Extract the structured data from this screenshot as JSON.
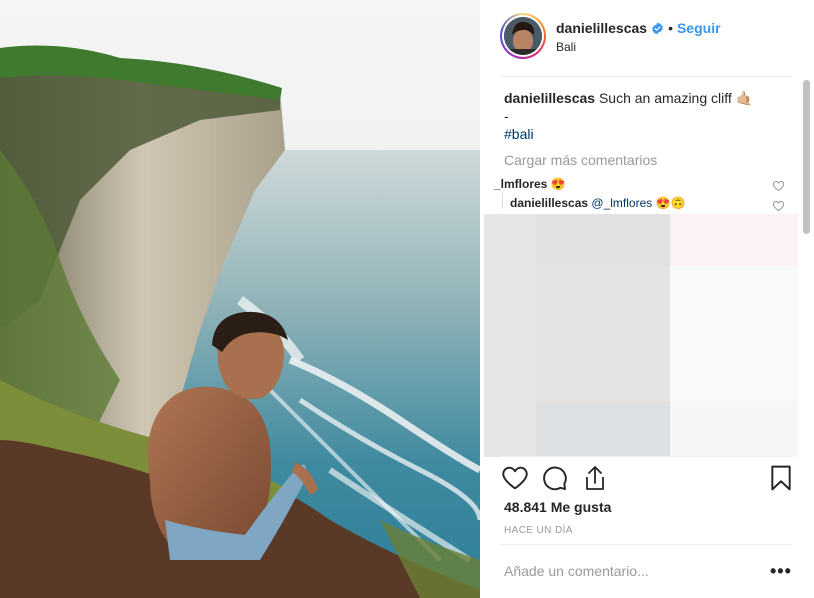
{
  "post": {
    "image_alt": "Man sitting on a cliff edge above the ocean",
    "author": {
      "username": "danielillescas",
      "verified": true,
      "separator": "•",
      "follow_label": "Seguir",
      "location": "Bali"
    },
    "caption": {
      "username": "danielillescas",
      "text": "Such an amazing cliff 🤙🏼",
      "line2": "-",
      "hashtag": "#bali"
    },
    "load_more_label": "Cargar más comentarios",
    "comments": [
      {
        "username": "_lmflores",
        "text": "😍"
      },
      {
        "username": "danielillescas",
        "mention": "@_lmflores",
        "text": "😍🙃"
      }
    ],
    "likes_text": "48.841 Me gusta",
    "time_ago": "HACE UN DÍA",
    "comment_input": {
      "placeholder": "Añade un comentario...",
      "value": ""
    },
    "more_options": "•••"
  },
  "icons": {
    "like": "heart-icon",
    "comment": "comment-bubble-icon",
    "share": "share-icon",
    "save": "bookmark-icon",
    "verified": "verified-badge-icon",
    "comment_like": "small-heart-icon",
    "more": "more-options-icon"
  },
  "colors": {
    "link": "#3897f0",
    "hashtag": "#003569",
    "muted": "#999999",
    "verified": "#3897f0"
  }
}
